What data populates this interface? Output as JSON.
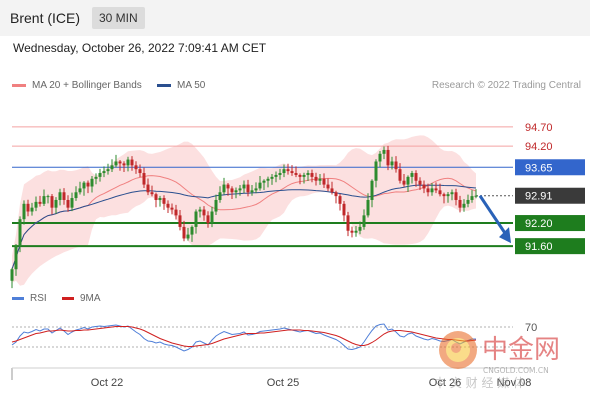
{
  "header": {
    "title": "Brent (ICE)",
    "timeframe": "30 MIN"
  },
  "datetime": "Wednesday, October 26, 2022 7:09:41 AM CET",
  "legend": {
    "ma20_label": "MA 20 + Bollinger Bands",
    "ma50_label": "MA 50",
    "copyright": "Research © 2022 Trading Central"
  },
  "colors": {
    "ma20": "#f08080",
    "ma50": "#2a4f8f",
    "bull": "#2e8b2e",
    "bear": "#c0282a",
    "band_fill": "#fbd6d6",
    "resistance": "#f4a2a2",
    "pivot": "#3366cc",
    "support": "#1e7d1e",
    "current": "#555555",
    "rsi": "#4f7fd8",
    "rsi_ma": "#d02020"
  },
  "chart_data": {
    "type": "candlestick",
    "ylim": [
      90.85,
      95.45
    ],
    "levels": [
      {
        "value": 94.7,
        "label": "94.70",
        "kind": "resistance"
      },
      {
        "value": 94.2,
        "label": "94.20",
        "kind": "resistance"
      },
      {
        "value": 93.65,
        "label": "93.65",
        "kind": "pivot"
      },
      {
        "value": 92.91,
        "label": "92.91",
        "kind": "current"
      },
      {
        "value": 92.2,
        "label": "92.20",
        "kind": "support"
      },
      {
        "value": 91.6,
        "label": "91.60",
        "kind": "support"
      }
    ],
    "x_labels": [
      "Oct 22",
      "Oct 25",
      "Oct 26",
      "Nov 08"
    ],
    "projection": {
      "from": 92.91,
      "to": 91.6
    },
    "close": [
      91.0,
      91.6,
      92.3,
      92.7,
      92.5,
      92.6,
      92.75,
      92.7,
      92.9,
      92.9,
      92.6,
      92.8,
      93.0,
      92.8,
      92.6,
      92.85,
      93.0,
      93.1,
      93.25,
      93.15,
      93.35,
      93.4,
      93.5,
      93.55,
      93.6,
      93.7,
      93.8,
      93.75,
      93.7,
      93.85,
      93.7,
      93.6,
      93.5,
      93.2,
      93.0,
      92.95,
      92.8,
      92.85,
      92.7,
      92.6,
      92.55,
      92.4,
      92.1,
      91.8,
      91.9,
      92.1,
      92.5,
      92.55,
      92.4,
      92.2,
      92.5,
      92.8,
      93.0,
      93.2,
      93.1,
      93.0,
      93.05,
      93.1,
      93.2,
      93.0,
      93.05,
      93.1,
      93.25,
      93.3,
      93.35,
      93.4,
      93.45,
      93.5,
      93.6,
      93.55,
      93.5,
      93.45,
      93.4,
      93.45,
      93.5,
      93.4,
      93.3,
      93.35,
      93.2,
      93.1,
      93.0,
      92.9,
      92.7,
      92.4,
      92.0,
      91.95,
      92.0,
      92.1,
      92.4,
      92.8,
      93.3,
      93.8,
      94.0,
      94.1,
      93.7,
      93.8,
      93.6,
      93.3,
      93.2,
      93.4,
      93.5,
      93.3,
      93.2,
      93.1,
      93.0,
      93.1,
      93.05,
      92.95,
      92.9,
      92.95,
      93.0,
      92.8,
      92.6,
      92.7,
      92.8,
      92.9,
      92.91
    ],
    "rsi": {
      "label": "RSI",
      "ma_label": "9MA",
      "level_label": "70",
      "values": [
        34,
        40,
        52,
        60,
        58,
        61,
        65,
        62,
        66,
        66,
        58,
        63,
        68,
        62,
        55,
        60,
        64,
        66,
        69,
        66,
        70,
        71,
        72,
        71,
        72,
        73,
        74,
        72,
        70,
        72,
        66,
        60,
        55,
        47,
        42,
        41,
        38,
        40,
        36,
        34,
        33,
        30,
        26,
        22,
        25,
        30,
        40,
        42,
        38,
        34,
        44,
        52,
        57,
        61,
        58,
        55,
        56,
        57,
        60,
        54,
        55,
        57,
        61,
        62,
        63,
        64,
        65,
        66,
        68,
        66,
        64,
        62,
        60,
        62,
        63,
        60,
        57,
        58,
        54,
        51,
        48,
        45,
        40,
        33,
        26,
        25,
        27,
        30,
        40,
        52,
        63,
        72,
        75,
        76,
        64,
        66,
        60,
        52,
        50,
        56,
        58,
        52,
        49,
        46,
        44,
        47,
        45,
        42,
        41,
        43,
        45,
        40,
        36,
        40,
        43,
        46,
        46
      ],
      "ma_values": [
        40,
        42,
        45,
        48,
        51,
        54,
        57,
        58,
        60,
        62,
        62,
        63,
        64,
        63,
        62,
        62,
        63,
        63,
        64,
        64,
        65,
        66,
        67,
        68,
        69,
        70,
        71,
        71,
        71,
        71,
        70,
        68,
        66,
        63,
        59,
        55,
        51,
        47,
        44,
        41,
        38,
        36,
        34,
        32,
        31,
        31,
        32,
        33,
        34,
        35,
        37,
        40,
        43,
        46,
        48,
        50,
        52,
        54,
        56,
        57,
        57,
        57,
        58,
        58,
        59,
        60,
        61,
        62,
        63,
        64,
        64,
        64,
        64,
        63,
        63,
        62,
        61,
        60,
        59,
        57,
        55,
        53,
        50,
        46,
        42,
        38,
        35,
        33,
        33,
        35,
        39,
        44,
        50,
        56,
        60,
        62,
        63,
        63,
        62,
        61,
        60,
        58,
        56,
        54,
        52,
        50,
        48,
        47,
        46,
        45,
        45,
        44,
        43,
        42,
        42,
        43,
        44
      ]
    }
  },
  "watermark": {
    "brand": "中金网",
    "slogan": "中 文 财 经 媒 体",
    "domain": "CNGOLD.COM.CN"
  }
}
